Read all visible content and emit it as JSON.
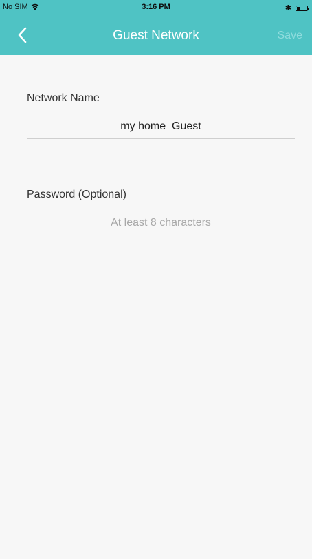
{
  "status_bar": {
    "carrier": "No SIM",
    "time": "3:16 PM",
    "bluetooth": "✱",
    "battery_level": 0.35
  },
  "nav": {
    "title": "Guest Network",
    "save_label": "Save",
    "back_icon": "chevron-left-icon"
  },
  "form": {
    "network_name_label": "Network Name",
    "network_name_value": "my home_Guest",
    "password_label": "Password (Optional)",
    "password_value": "",
    "password_placeholder": "At least 8 characters"
  },
  "colors": {
    "accent": "#4fc3c4",
    "save_disabled": "#8fdcdd",
    "background": "#f7f7f7"
  }
}
